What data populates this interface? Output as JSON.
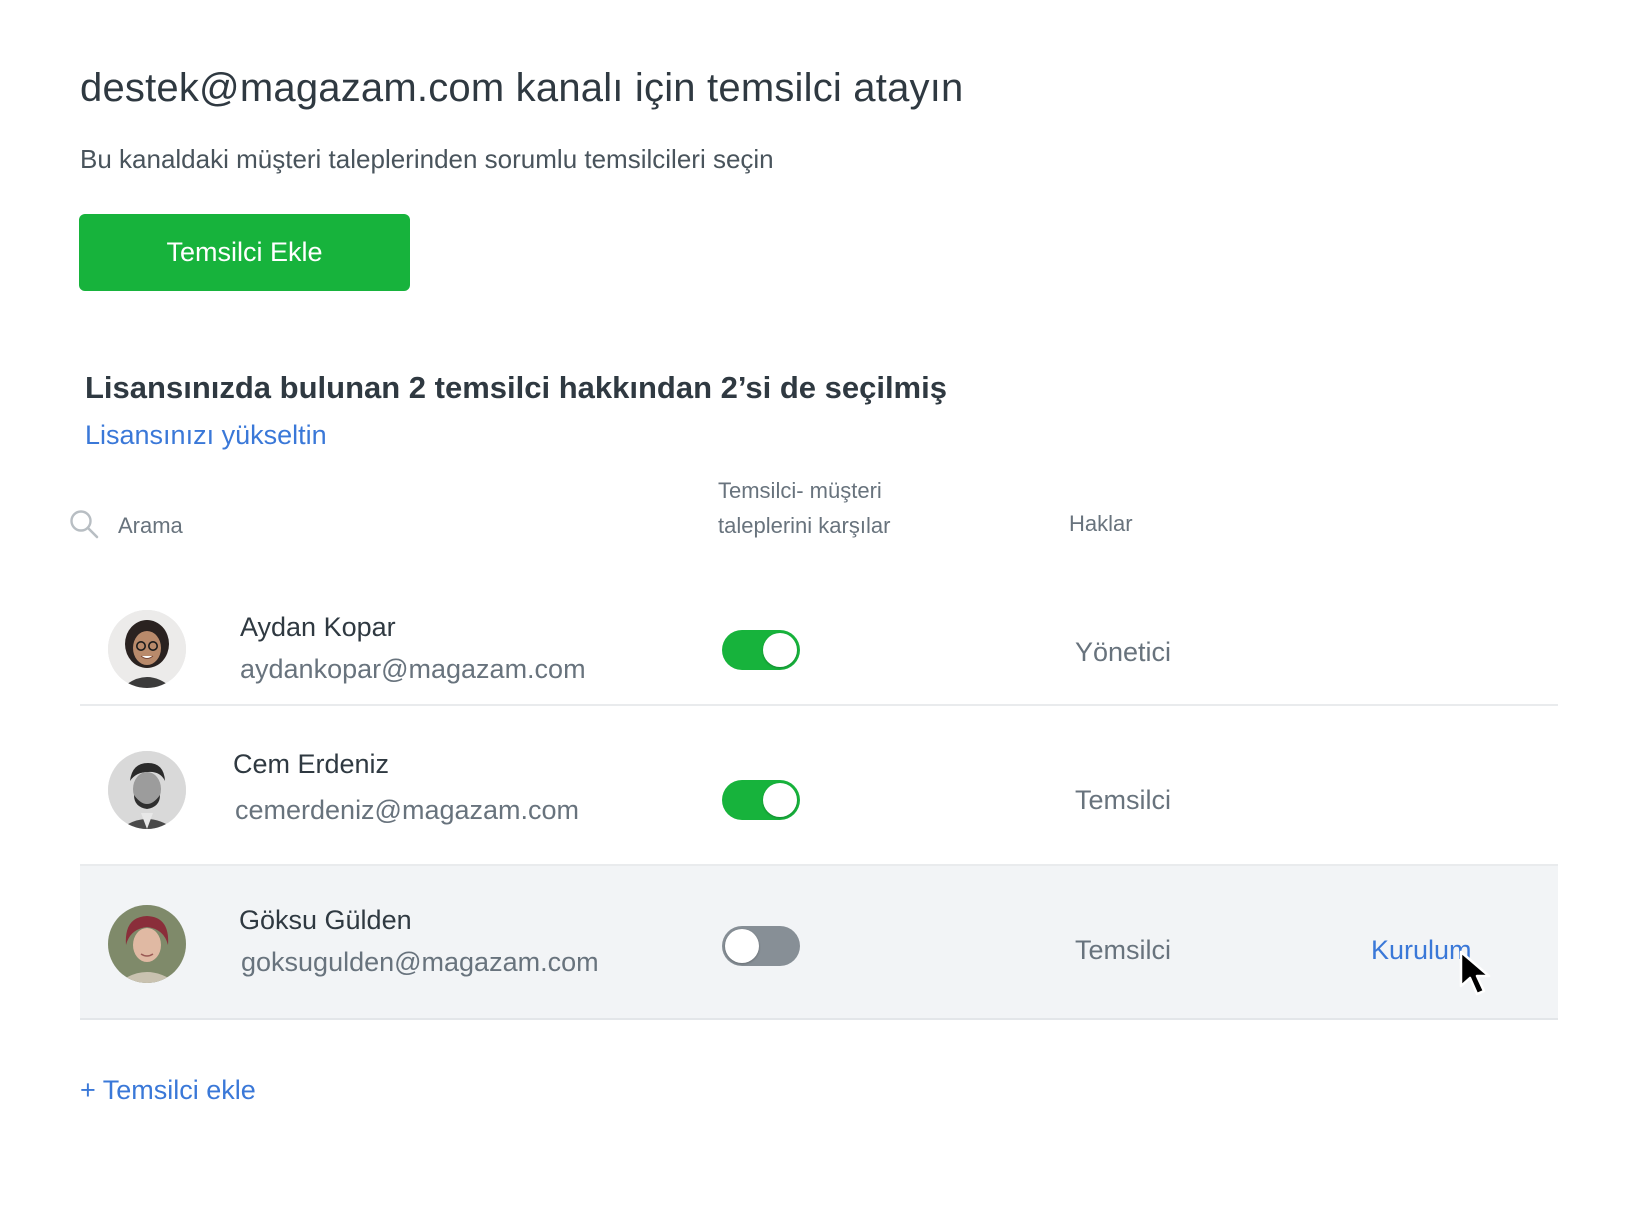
{
  "header": {
    "title": "destek@magazam.com kanalı için temsilci atayın",
    "subtitle": "Bu kanaldaki müşteri taleplerinden sorumlu temsilcileri seçin",
    "add_button_label": "Temsilci Ekle"
  },
  "license": {
    "title": "Lisansınızda bulunan 2 temsilci hakkından 2’si de seçilmiş",
    "upgrade_link": "Lisansınızı yükseltin"
  },
  "table": {
    "search_placeholder": "Arama",
    "col_toggle_line1": "Temsilci- müşteri",
    "col_toggle_line2": "taleplerini karşılar",
    "col_rights": "Haklar",
    "rows": [
      {
        "name": "Aydan Kopar",
        "email": "aydankopar@magazam.com",
        "active": true,
        "role": "Yönetici"
      },
      {
        "name": "Cem Erdeniz",
        "email": "cemerdeniz@magazam.com",
        "active": true,
        "role": "Temsilci"
      },
      {
        "name": "Göksu Gülden",
        "email": "goksugulden@magazam.com",
        "active": false,
        "role": "Temsilci",
        "action": "Kurulum"
      }
    ]
  },
  "footer": {
    "add_link": "+ Temsilci ekle"
  },
  "colors": {
    "accent_green": "#17b33c",
    "link_blue": "#3a78d8",
    "toggle_off": "#878f96",
    "highlight_row": "#f2f4f6"
  }
}
